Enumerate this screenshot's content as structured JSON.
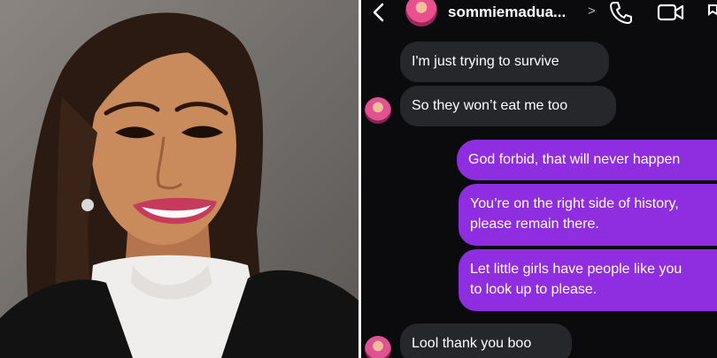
{
  "header": {
    "username": "sommiemadua...",
    "chevron": ">",
    "icons": [
      "back-arrow-icon",
      "profile-avatar",
      "phone-icon",
      "video-call-icon"
    ]
  },
  "messages": [
    {
      "side": "in",
      "text": "I'm just trying to survive"
    },
    {
      "side": "in",
      "text": "So they won’t eat me too"
    },
    {
      "side": "out",
      "text": "God forbid, that will never happen"
    },
    {
      "side": "out",
      "text": "You’re on the right side of history,"
    },
    {
      "side": "out",
      "text": "please remain there."
    },
    {
      "side": "out",
      "text": "Let little girls have people like you"
    },
    {
      "side": "out",
      "text": "to look up to please."
    },
    {
      "side": "in",
      "text": "Lool thank you boo"
    }
  ],
  "colors": {
    "incoming_bubble": "#26272b",
    "outgoing_bubble": "#8e2ee0",
    "background": "#0b0b0d"
  }
}
